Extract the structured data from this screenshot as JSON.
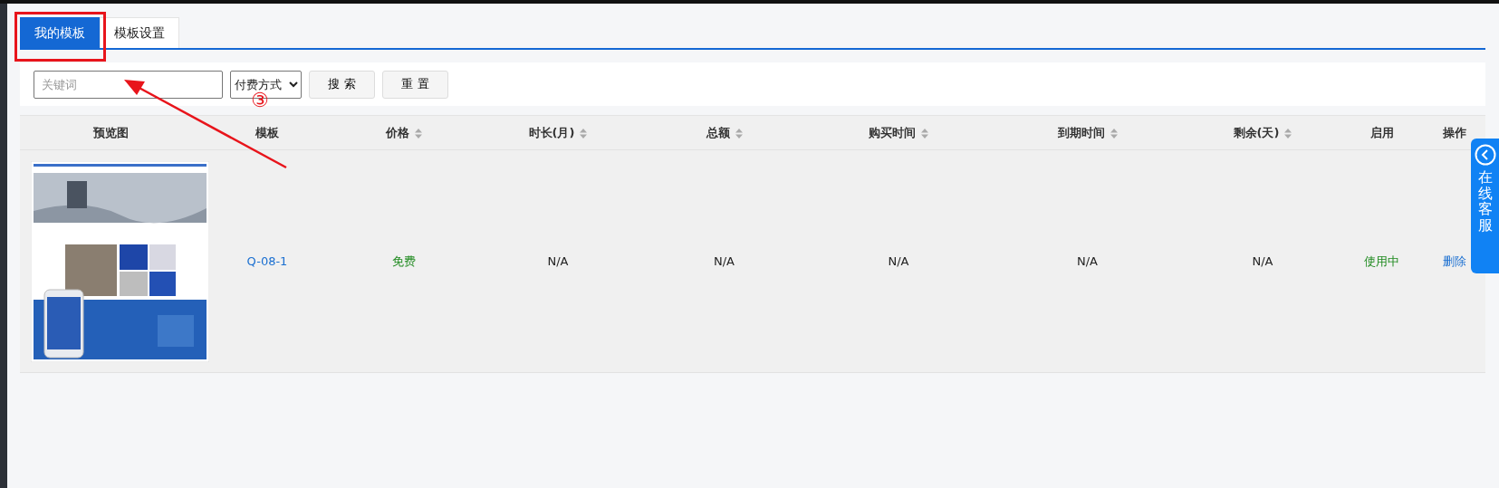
{
  "tabs": [
    {
      "label": "我的模板",
      "selected": true
    },
    {
      "label": "模板设置",
      "selected": false
    }
  ],
  "filters": {
    "search": {
      "placeholder": "关键词"
    },
    "payment_select": {
      "value": "付费方式"
    },
    "buttons": [
      "搜 索",
      "重 置"
    ]
  },
  "table": {
    "columns": [
      {
        "label": "预览图",
        "sortable": false
      },
      {
        "label": "模板",
        "sortable": false
      },
      {
        "label": "价格",
        "sortable": true
      },
      {
        "label": "时长(月)",
        "sortable": true
      },
      {
        "label": "总额",
        "sortable": true
      },
      {
        "label": "购买时间",
        "sortable": true
      },
      {
        "label": "到期时间",
        "sortable": true
      },
      {
        "label": "剩余(天)",
        "sortable": true
      },
      {
        "label": "启用",
        "sortable": false
      },
      {
        "label": "操作",
        "sortable": false
      }
    ],
    "rows": [
      {
        "template": "Q-08-1",
        "price": "免费",
        "duration": "N/A",
        "total": "N/A",
        "purchase_time": "N/A",
        "expire_time": "N/A",
        "remaining": "N/A",
        "status": "使用中",
        "action": "删除"
      }
    ]
  },
  "support_widget": {
    "label": "在线客服"
  },
  "annotation": {
    "label": "③"
  }
}
